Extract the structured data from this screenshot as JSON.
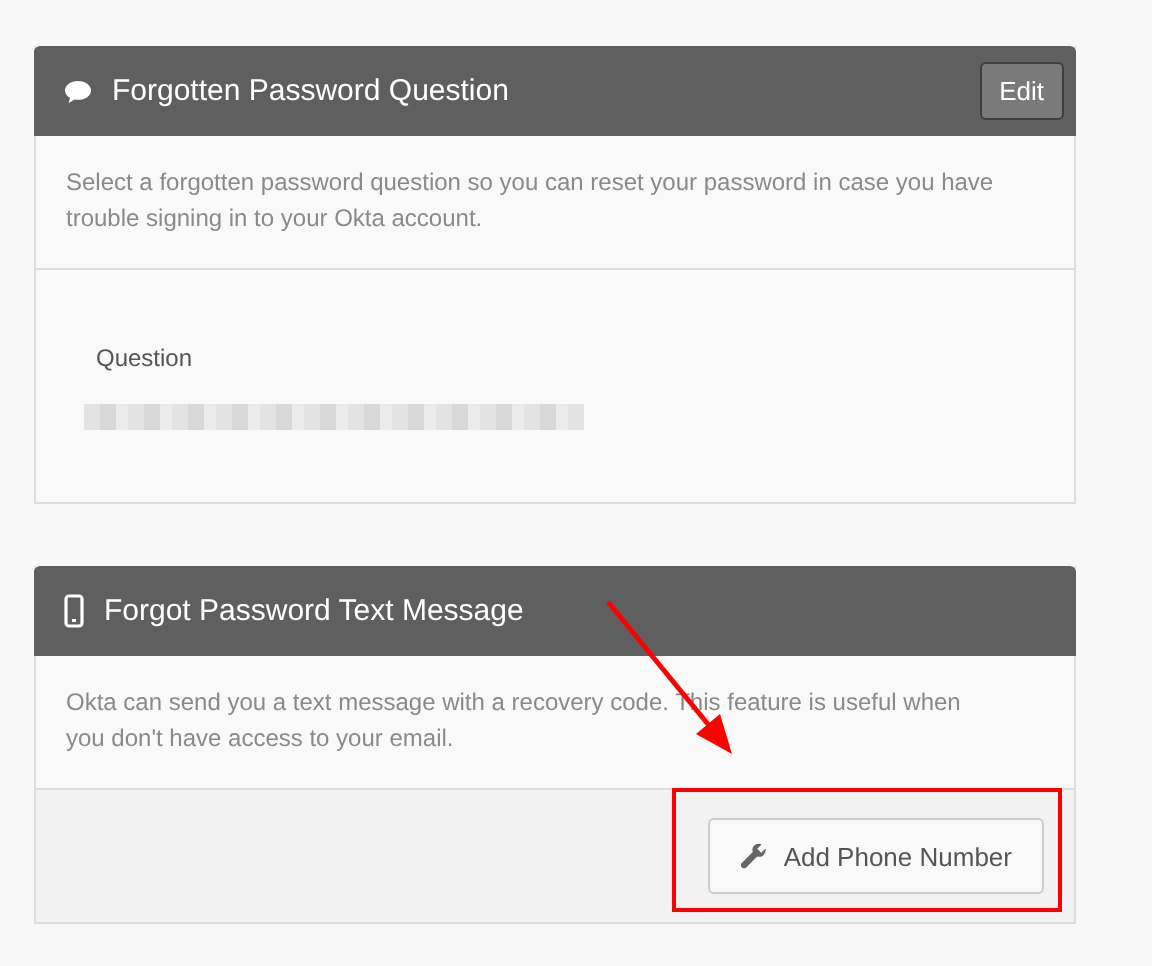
{
  "cards": [
    {
      "title": "Forgotten Password Question",
      "header_button": "Edit",
      "description": "Select a forgotten password question so you can reset your password in case you have trouble signing in to your Okta account.",
      "field": {
        "label": "Question"
      }
    },
    {
      "title": "Forgot Password Text Message",
      "description": "Okta can send you a text message with a recovery code. This feature is useful when you don't have access to your email.",
      "footer_button": {
        "label": "Add Phone Number"
      }
    }
  ]
}
